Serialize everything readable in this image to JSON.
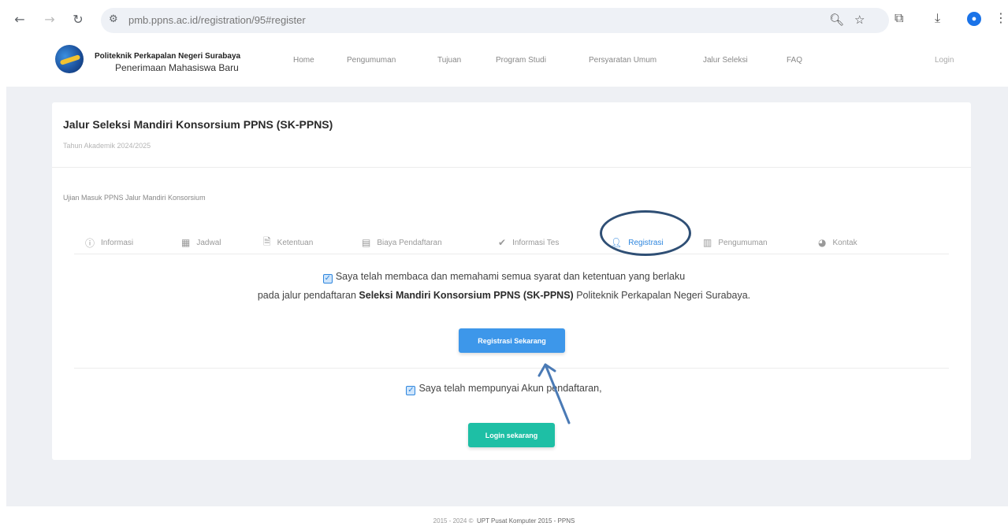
{
  "browser": {
    "url": "pmb.ppns.ac.id/registration/95#register",
    "icons": [
      "back-icon",
      "forward-icon",
      "reload-icon",
      "site-info-icon",
      "zoom-icon",
      "star-icon",
      "extensions-icon",
      "download-icon",
      "profile-icon",
      "menu-icon"
    ]
  },
  "header": {
    "brand_top": "Politeknik Perkapalan Negeri Surabaya",
    "brand_bottom": "Penerimaan Mahasiswa Baru",
    "nav": [
      "Home",
      "Pengumuman",
      "Tujuan",
      "Program Studi",
      "Persyaratan Umum",
      "Jalur Seleksi",
      "FAQ"
    ],
    "login": "Login"
  },
  "card": {
    "title": "Jalur Seleksi Mandiri Konsorsium PPNS (SK-PPNS)",
    "subtitle": "Tahun Akademik 2024/2025",
    "section_label": "Ujian Masuk PPNS Jalur Mandiri Konsorsium",
    "tabs": [
      {
        "label": "Informasi",
        "icon": "info-icon"
      },
      {
        "label": "Jadwal",
        "icon": "calendar-icon"
      },
      {
        "label": "Ketentuan",
        "icon": "document-icon"
      },
      {
        "label": "Biaya Pendaftaran",
        "icon": "receipt-icon"
      },
      {
        "label": "Informasi Tes",
        "icon": "check-icon"
      },
      {
        "label": "Registrasi",
        "icon": "user-icon"
      },
      {
        "label": "Pengumuman",
        "icon": "announcement-icon"
      },
      {
        "label": "Kontak",
        "icon": "contact-icon"
      }
    ],
    "active_tab": "Registrasi",
    "agree_line1": "Saya telah membaca dan memahami semua syarat dan ketentuan yang berlaku",
    "agree_line2_pre": "pada jalur pendaftaran ",
    "agree_line2_bold": "Seleksi Mandiri Konsorsium PPNS (SK-PPNS)",
    "agree_line2_post": " Politeknik Perkapalan Negeri Surabaya.",
    "register_button": "Registrasi Sekarang",
    "account_text": "Saya telah mempunyai Akun pendaftaran,",
    "login_button": "Login sekarang"
  },
  "footer": {
    "years": "2015 - 2024 ©",
    "owner": "UPT Pusat Komputer 2015 - PPNS"
  },
  "colors": {
    "accent": "#2e86de",
    "register_button": "#3d97ea",
    "login_button": "#1ebfa5",
    "annotation": "#2f4f75",
    "page_bg": "#eef0f4"
  }
}
